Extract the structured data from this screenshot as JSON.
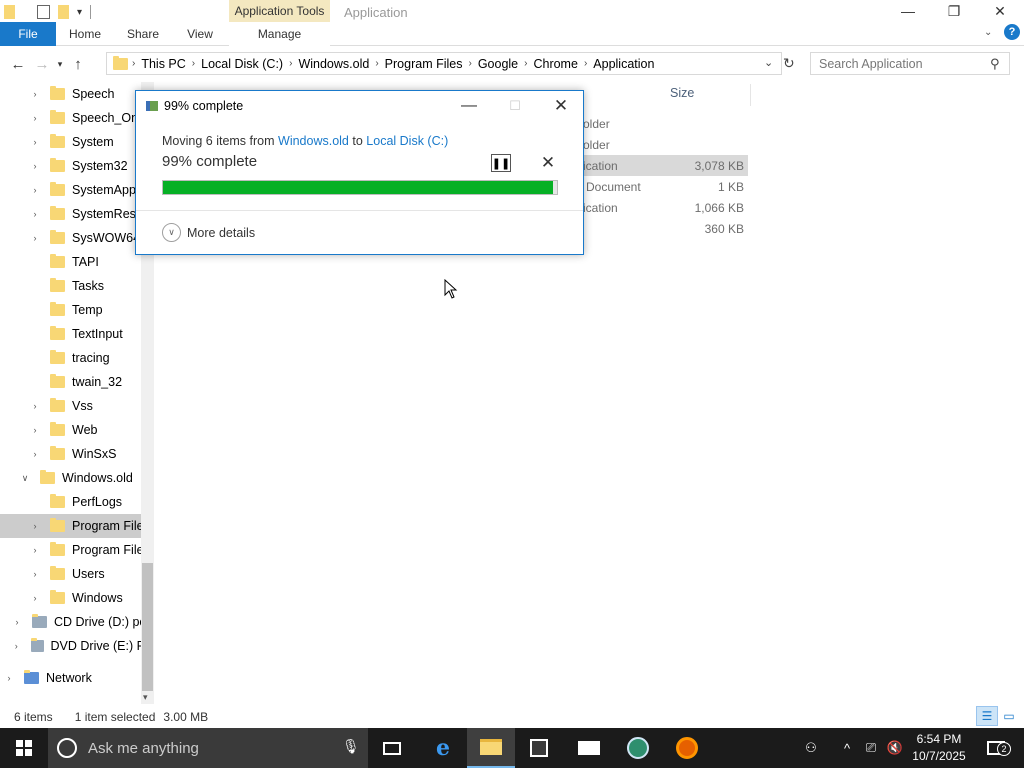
{
  "titlebar": {
    "context_tab": "Application Tools",
    "window_title": "Application",
    "qat_dropdown": "="
  },
  "ribbon": {
    "tabs": [
      "File",
      "Home",
      "Share",
      "View",
      "Manage"
    ]
  },
  "address": {
    "crumbs": [
      "This PC",
      "Local Disk (C:)",
      "Windows.old",
      "Program Files",
      "Google",
      "Chrome",
      "Application"
    ]
  },
  "search": {
    "placeholder": "Search Application"
  },
  "navpane": {
    "items": [
      {
        "label": "Speech",
        "expandable": true
      },
      {
        "label": "Speech_One",
        "expandable": true
      },
      {
        "label": "System",
        "expandable": true
      },
      {
        "label": "System32",
        "expandable": true
      },
      {
        "label": "SystemApps",
        "expandable": true
      },
      {
        "label": "SystemReso",
        "expandable": true
      },
      {
        "label": "SysWOW64",
        "expandable": true
      },
      {
        "label": "TAPI",
        "expandable": false
      },
      {
        "label": "Tasks",
        "expandable": false
      },
      {
        "label": "Temp",
        "expandable": false
      },
      {
        "label": "TextInput",
        "expandable": false
      },
      {
        "label": "tracing",
        "expandable": false
      },
      {
        "label": "twain_32",
        "expandable": false
      },
      {
        "label": "Vss",
        "expandable": true
      },
      {
        "label": "Web",
        "expandable": true
      },
      {
        "label": "WinSxS",
        "expandable": true
      },
      {
        "label": "Windows.old",
        "expandable": true,
        "expanded": true
      },
      {
        "label": "PerfLogs",
        "expandable": false
      },
      {
        "label": "Program Files",
        "expandable": true,
        "selected": true
      },
      {
        "label": "Program Files",
        "expandable": true
      },
      {
        "label": "Users",
        "expandable": true
      },
      {
        "label": "Windows",
        "expandable": true
      },
      {
        "label": "CD Drive (D:) per",
        "expandable": true
      },
      {
        "label": "DVD Drive (E:) RE",
        "expandable": true
      },
      {
        "label": "Network",
        "expandable": true
      }
    ]
  },
  "filelist": {
    "size_header": "Size",
    "rows": [
      {
        "type": "older",
        "size": ""
      },
      {
        "type": "older",
        "size": ""
      },
      {
        "type": "ication",
        "size": "3,078 KB"
      },
      {
        "type": "Document",
        "size": "1 KB"
      },
      {
        "type": "ication",
        "size": "1,066 KB"
      },
      {
        "type": "",
        "size": "360 KB"
      }
    ]
  },
  "status": {
    "items": "6 items",
    "selected": "1 item selected",
    "size": "3.00 MB"
  },
  "dialog": {
    "title": "99% complete",
    "moving_prefix": "Moving 6 items from",
    "from": "Windows.old",
    "to_word": "to",
    "to": "Local Disk (C:)",
    "big_status": "99% complete",
    "progress": 0.99,
    "more_details": "More details"
  },
  "taskbar": {
    "search_placeholder": "Ask me anything",
    "time": "6:54 PM",
    "date": "10/7/2025",
    "notification_count": "2"
  },
  "colors": {
    "accent": "#1979ca",
    "progress": "#06b025",
    "taskbar": "#1b1b1b"
  }
}
